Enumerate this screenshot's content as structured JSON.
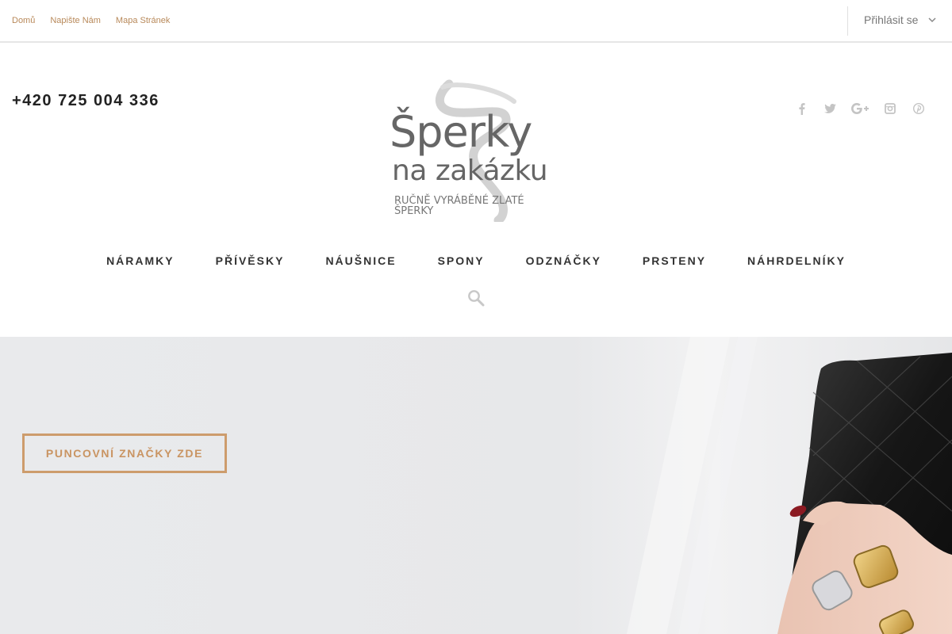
{
  "topbar": {
    "links": [
      "Domů",
      "Napište Nám",
      "Mapa Stránek"
    ],
    "login_label": "Přihlásit se"
  },
  "header": {
    "phone": "+420 725 004 336",
    "logo": {
      "line1": "Šperky",
      "line2": "na zakázku",
      "tagline": "RUČNĚ VYRÁBĚNÉ ZLATÉ ŠPERKY"
    },
    "social_icons": [
      "facebook-icon",
      "twitter-icon",
      "google-plus-icon",
      "instagram-icon",
      "pinterest-icon"
    ]
  },
  "nav": {
    "items": [
      "NÁRAMKY",
      "PŘÍVĚSKY",
      "NÁUŠNICE",
      "SPONY",
      "ODZNÁČKY",
      "PRSTENY",
      "NÁHRDELNÍKY"
    ],
    "search_icon": "search-icon"
  },
  "hero": {
    "button_label": "PUNCOVNÍ ZNAČKY ZDE"
  },
  "colors": {
    "accent": "#cd9c6c",
    "link": "#b8895a",
    "nav_text": "#333333",
    "hero_bg": "#e8e9eb"
  }
}
